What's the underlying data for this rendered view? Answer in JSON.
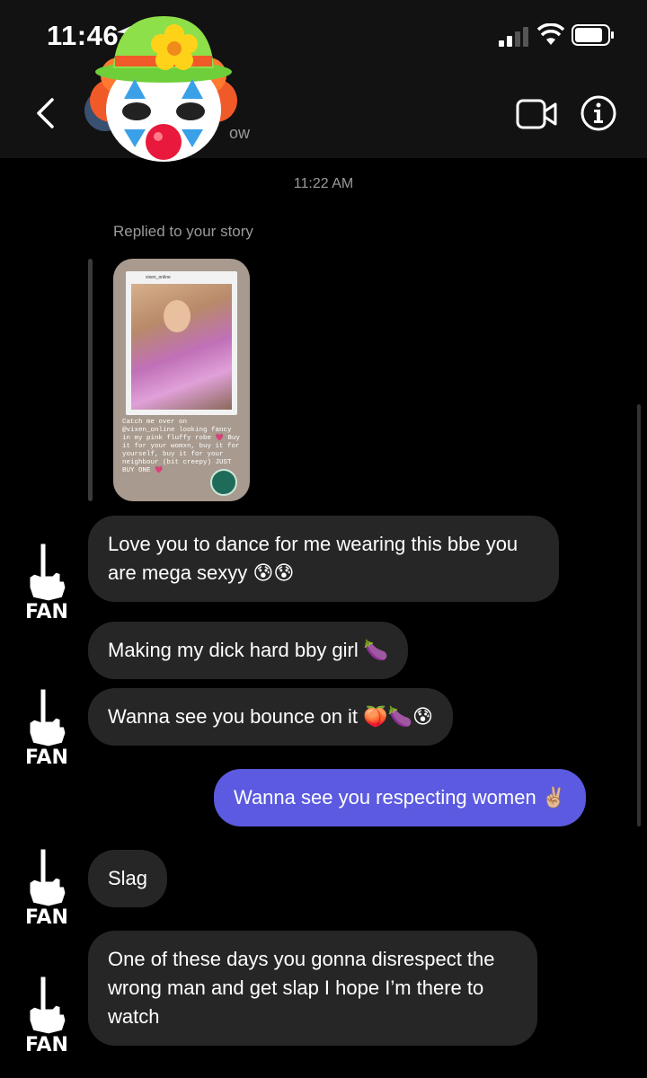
{
  "status_bar": {
    "time": "11:46"
  },
  "header": {
    "subtitle_fragment": "w"
  },
  "chat": {
    "timestamp": "11:22 AM",
    "replied_label": "Replied to your story",
    "story": {
      "handle": "vixen_online",
      "caption": "Catch me over on @vixen_online looking fancy in my pink fluffy robe 💗 Buy it for your womxn, buy it for yourself, buy it for your neighbour (bit creepy) JUST BUY ONE 💗"
    },
    "messages": [
      {
        "text": "Love you to dance for me wearing this bbe you are mega sexyy 😰😰",
        "from": "them"
      },
      {
        "text": "Making my dick hard bby girl 🍆",
        "from": "them"
      },
      {
        "text": "Wanna see you bounce on it 🍑🍆😰",
        "from": "them"
      },
      {
        "text": "Wanna see you respecting women ✌🏼",
        "from": "me"
      },
      {
        "text": "Slag",
        "from": "them"
      },
      {
        "text": "One of these days you gonna disrespect the wrong man and get slap I hope I’m there to watch",
        "from": "them"
      }
    ],
    "fan_label": "FAN"
  },
  "colors": {
    "my_bubble": "#5b5ae0",
    "their_bubble": "#262626",
    "background": "#000000",
    "header": "#121212"
  }
}
